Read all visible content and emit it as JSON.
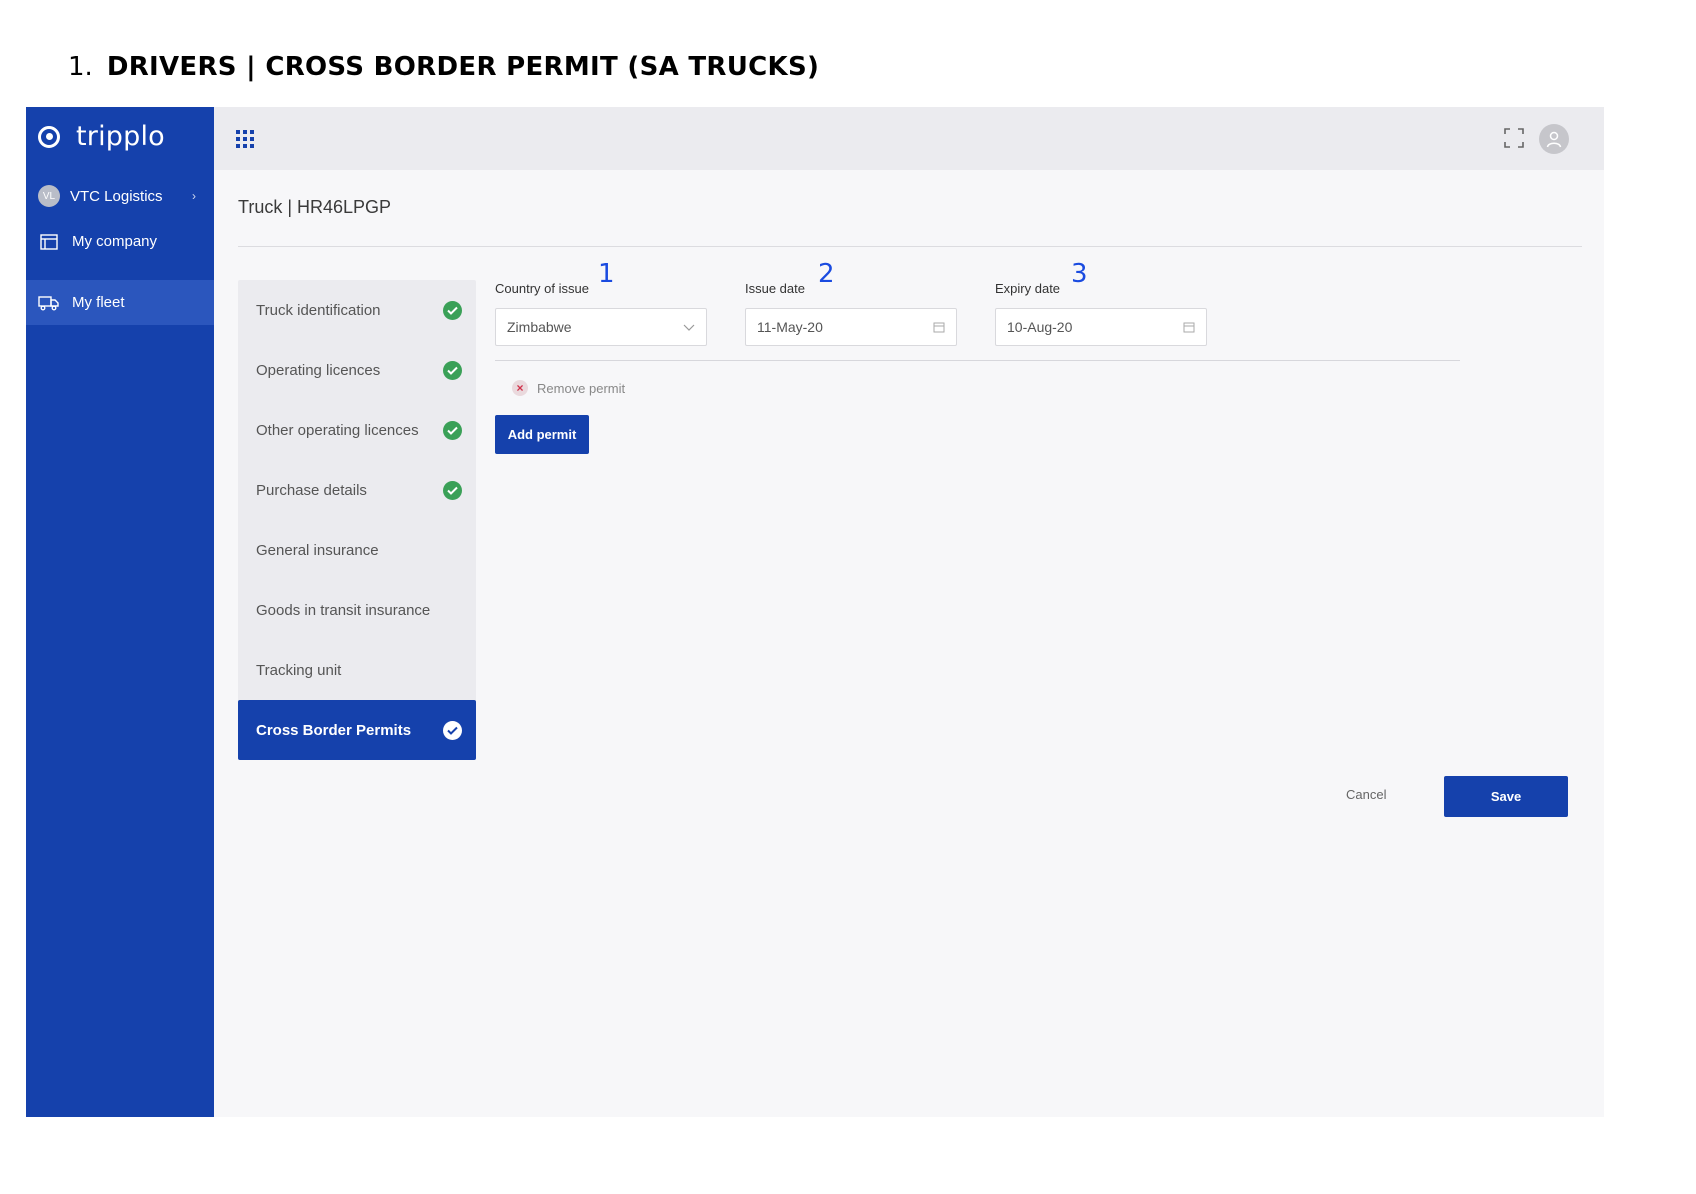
{
  "document": {
    "heading_number": "1.",
    "heading_text": "DRIVERS | CROSS BORDER PERMIT (SA TRUCKS)"
  },
  "app": {
    "logo_text": "tripplo",
    "brand_color": "#1541ac",
    "success_color": "#3aa057"
  },
  "sidebar": {
    "org": {
      "initials": "VL",
      "name": "VTC Logistics"
    },
    "items": [
      {
        "label": "My company",
        "icon": "building-icon",
        "active": false
      },
      {
        "label": "My fleet",
        "icon": "truck-icon",
        "active": true
      }
    ]
  },
  "topbar": {
    "icons": [
      "apps-grid-icon",
      "fullscreen-icon",
      "user-avatar-icon"
    ]
  },
  "page": {
    "title": "Truck | HR46LPGP"
  },
  "steps": [
    {
      "label": "Truck identification",
      "complete": true
    },
    {
      "label": "Operating licences",
      "complete": true
    },
    {
      "label": "Other operating licences",
      "complete": true
    },
    {
      "label": "Purchase details",
      "complete": true
    },
    {
      "label": "General insurance",
      "complete": false
    },
    {
      "label": "Goods in transit insurance",
      "complete": false
    },
    {
      "label": "Tracking unit",
      "complete": false
    },
    {
      "label": "Cross Border Permits",
      "complete": true,
      "active": true
    }
  ],
  "form": {
    "country": {
      "label": "Country of issue",
      "value": "Zimbabwe",
      "marker": "1"
    },
    "issue_date": {
      "label": "Issue date",
      "value": "11-May-20",
      "marker": "2"
    },
    "expiry_date": {
      "label": "Expiry date",
      "value": "10-Aug-20",
      "marker": "3"
    },
    "remove_label": "Remove permit",
    "add_label": "Add permit"
  },
  "actions": {
    "cancel": "Cancel",
    "save": "Save"
  }
}
